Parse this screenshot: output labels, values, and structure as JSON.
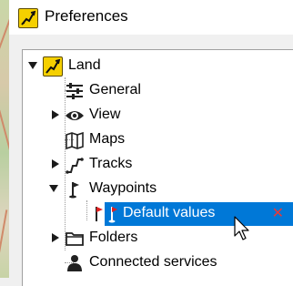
{
  "window": {
    "title": "Preferences"
  },
  "tree": {
    "root": {
      "label": "Land",
      "icon": "land-icon",
      "expanded": true
    },
    "items": [
      {
        "label": "General",
        "icon": "sliders-icon",
        "expander": "none"
      },
      {
        "label": "View",
        "icon": "eye-icon",
        "expander": "collapsed"
      },
      {
        "label": "Maps",
        "icon": "map-icon",
        "expander": "none"
      },
      {
        "label": "Tracks",
        "icon": "track-icon",
        "expander": "collapsed"
      },
      {
        "label": "Waypoints",
        "icon": "flag-icon",
        "expander": "expanded",
        "children": [
          {
            "label": "Default values",
            "icon": "waypoint-flag-icon",
            "selected": true,
            "action": "✕"
          }
        ]
      },
      {
        "label": "Folders",
        "icon": "folder-icon",
        "expander": "collapsed"
      },
      {
        "label": "Connected services",
        "icon": "user-icon",
        "expander": "none"
      }
    ]
  },
  "colors": {
    "selection": "#0078d7",
    "delete_x": "#e53a3a",
    "app_icon": "#f5d000"
  }
}
